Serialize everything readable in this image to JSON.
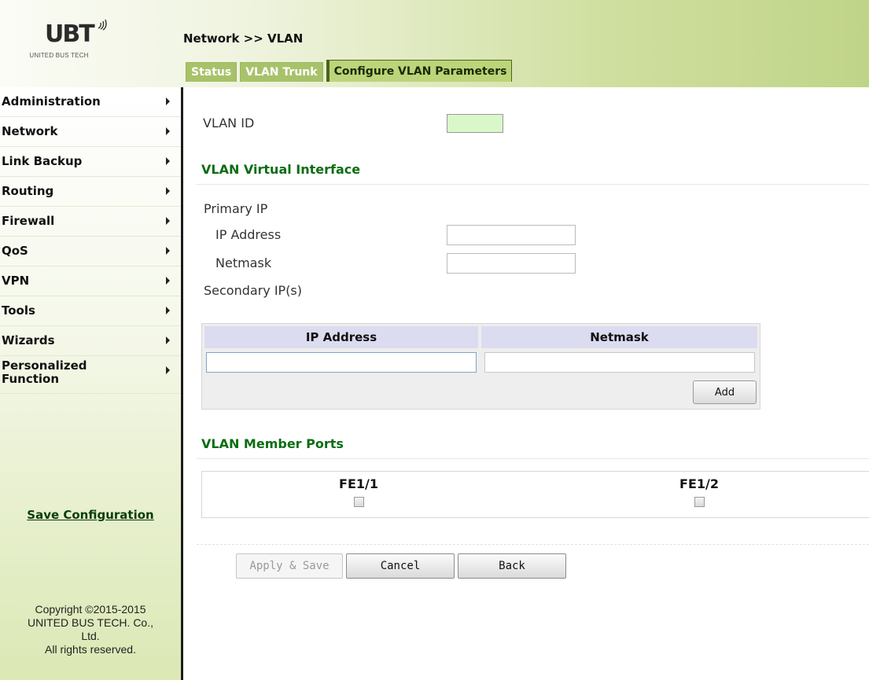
{
  "brand": {
    "logo_text": "UBT",
    "company_subtitle": "UNITED BUS TECH"
  },
  "breadcrumb": "Network >> VLAN",
  "tabs": [
    {
      "label": "Status",
      "active": false
    },
    {
      "label": "VLAN Trunk",
      "active": false
    },
    {
      "label": "Configure VLAN Parameters",
      "active": true
    }
  ],
  "sidebar": {
    "items": [
      {
        "label": "Administration"
      },
      {
        "label": "Network"
      },
      {
        "label": "Link Backup"
      },
      {
        "label": "Routing"
      },
      {
        "label": "Firewall"
      },
      {
        "label": "QoS"
      },
      {
        "label": "VPN"
      },
      {
        "label": "Tools"
      },
      {
        "label": "Wizards"
      },
      {
        "label": "Personalized Function"
      }
    ],
    "save_configuration": "Save Configuration",
    "copyright": {
      "line1": "Copyright ©2015-2015",
      "line2": "UNITED BUS TECH. Co.,",
      "line3": "Ltd.",
      "line4": "All rights reserved."
    }
  },
  "form": {
    "vlan_id_label": "VLAN ID",
    "vlan_id_value": "",
    "virtual_interface_title": "VLAN Virtual Interface",
    "primary_ip_label": "Primary IP",
    "ip_address_label": "IP Address",
    "ip_address_value": "",
    "netmask_label": "Netmask",
    "netmask_value": "",
    "secondary_ip_label": "Secondary IP(s)",
    "secondary_table": {
      "headers": [
        "IP Address",
        "Netmask"
      ],
      "ip_value": "",
      "netmask_value": "",
      "add_button": "Add"
    },
    "member_ports_title": "VLAN Member Ports",
    "ports": [
      {
        "name": "FE1/1",
        "checked": false
      },
      {
        "name": "FE1/2",
        "checked": false
      }
    ]
  },
  "buttons": {
    "apply_save": "Apply & Save",
    "cancel": "Cancel",
    "back": "Back"
  },
  "colors": {
    "section_title": "#0b6d12",
    "active_tab_bg": "#bcd47a",
    "inactive_tab_bg": "#a8c26a",
    "vlan_input_bg": "#d9f7c9"
  }
}
